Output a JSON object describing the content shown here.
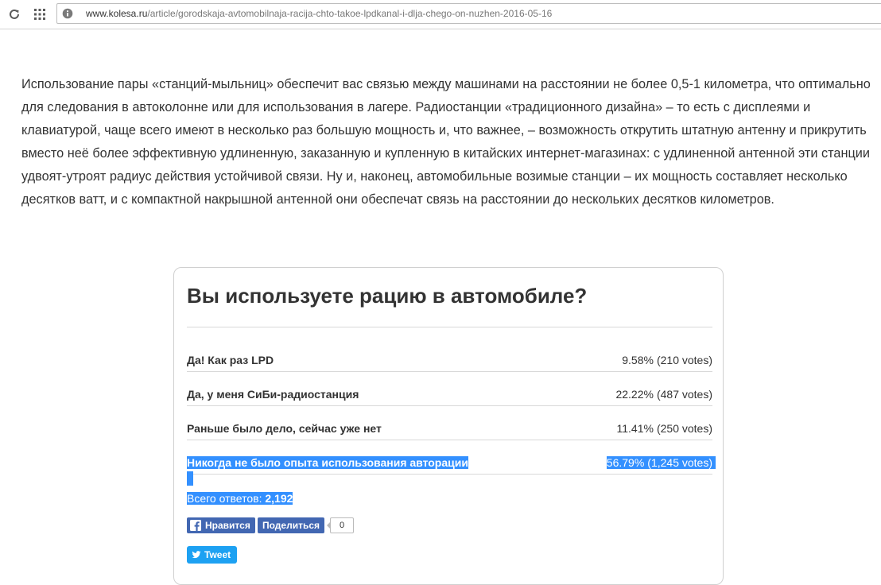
{
  "browser": {
    "url_host": "www.kolesa.ru",
    "url_path": "/article/gorodskaja-avtomobilnaja-racija-chto-takoe-lpdkanal-i-dlja-chego-on-nuzhen-2016-05-16"
  },
  "article": {
    "paragraph": "Использование пары «станций-мыльниц» обеспечит вас связью между машинами на расстоянии не более 0,5-1 километра, что оптимально для следования в автоколонне или для использования в лагере. Радиостанции «традиционного дизайна» – то есть с дисплеями и клавиатурой, чаще всего имеют в несколько раз большую мощность и, что важнее, – возможность открутить штатную антенну и прикрутить вместо неё более эффективную удлиненную, заказанную и купленную в китайских интернет-магазинах: с удлиненной антенной эти станции удвоят-утроят радиус действия устойчивой связи. Ну и, наконец, автомобильные возимые станции – их мощность составляет несколько десятков ватт, и с компактной накрышной антенной они обеспечат связь на расстоянии до нескольких десятков километров."
  },
  "poll": {
    "title": "Вы используете рацию в автомобиле?",
    "answers": [
      {
        "label": "Да! Как раз LPD",
        "percent": "9.58%",
        "votes": "(210 votes)"
      },
      {
        "label": "Да, у меня СиБи-радиостанция",
        "percent": "22.22%",
        "votes": "(487 votes)"
      },
      {
        "label": "Раньше было дело, сейчас уже нет",
        "percent": "11.41%",
        "votes": "(250 votes)"
      },
      {
        "label": "Никогда не было опыта использования авторации",
        "percent": "56.79%",
        "votes": "(1,245 votes)"
      }
    ],
    "total_label": "Всего ответов:",
    "total_value": "2,192"
  },
  "social": {
    "like_label": "Нравится",
    "share_label": "Поделиться",
    "share_count": "0",
    "tweet_label": "Tweet"
  },
  "colors": {
    "selection": "#3390ff",
    "facebook": "#4267b2",
    "twitter": "#1da1f2"
  },
  "icons": [
    "reload-icon",
    "apps-icon",
    "page-info-icon",
    "facebook-icon",
    "twitter-icon"
  ]
}
